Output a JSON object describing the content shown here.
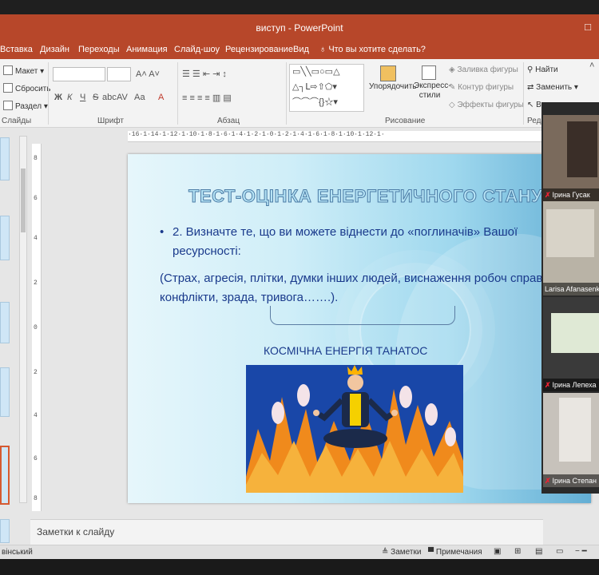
{
  "app": {
    "title": "виступ - PowerPoint",
    "quick_access": "",
    "window_controls": "□"
  },
  "tabs": [
    "Вставка",
    "Дизайн",
    "Переходы",
    "Анимация",
    "Слайд-шоу",
    "Рецензирование",
    "Вид",
    "Что вы хотите сделать?"
  ],
  "tab_tell_icon": "lightbulb-icon",
  "ribbon": {
    "slides": {
      "layout": "Макет",
      "reset": "Сбросить",
      "section": "Раздел",
      "label": "Слайды"
    },
    "font": {
      "label": "Шрифт",
      "bold": "Ж",
      "italic": "К",
      "underline": "Ч",
      "strike": "S",
      "shadow": "abc",
      "spacing": "AV",
      "case": "Аа",
      "color": "A"
    },
    "paragraph": {
      "label": "Абзац"
    },
    "drawing": {
      "label": "Рисование",
      "arrange": "Упорядочить",
      "quick_styles": "Экспресс-стили",
      "fill": "Заливка фигуры",
      "outline": "Контур фигуры",
      "effects": "Эффекты фигуры"
    },
    "editing": {
      "label": "Реда",
      "find": "Найти",
      "replace": "Заменить",
      "select": "В"
    }
  },
  "ruler": {
    "horizontal": "·16·1·14·1·12·1·10·1·8·1·6·1·4·1·2·1·0·1·2·1·4·1·6·1·8·1·10·1·12·1·",
    "vertical": [
      "8",
      "6",
      "4",
      "2",
      "0",
      "2",
      "4",
      "6",
      "8"
    ]
  },
  "slide": {
    "title": "ТЕСТ-ОЦІНКА ЕНЕРГЕТИЧНОГО СТАНУ",
    "bullet_marker": "•",
    "bullet": "2. Визначте те, що ви можете віднести до «поглиначів» Вашої ресурсності:",
    "paren": "(Страх, агресія, плітки, думки інших людей, виснаження робоч справами, конфлікти, зрада, тривога…….).",
    "subhead": "КОСМІЧНА ЕНЕРГІЯ ТАНАТОС"
  },
  "notes": {
    "placeholder": "Заметки к слайду"
  },
  "status": {
    "left": "вінський",
    "notes_btn": "Заметки",
    "comments_btn": "Примечания"
  },
  "videos": [
    {
      "name": "Ірина Гусак"
    },
    {
      "name": "Larisa Afanasenko"
    },
    {
      "name": "Ірина Лепеха"
    },
    {
      "name": "Ірина Степан"
    }
  ],
  "colors": {
    "titlebar": "#b7472a",
    "slide_text": "#1a3a8c",
    "picture_bg": "#1947a8",
    "flames": "#f08a1c"
  }
}
